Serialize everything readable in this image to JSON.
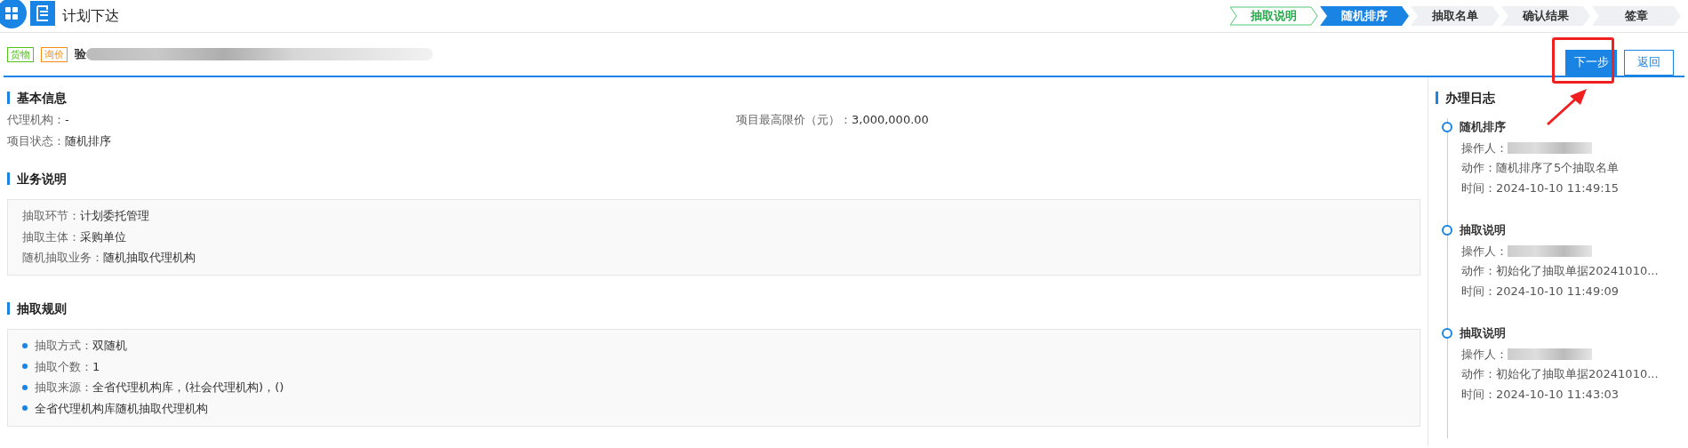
{
  "header": {
    "title": "计划下达"
  },
  "steps": [
    {
      "label": "抽取说明",
      "done": true,
      "selected": false
    },
    {
      "label": "随机排序",
      "done": false,
      "selected": true
    },
    {
      "label": "抽取名单",
      "done": false,
      "selected": false
    },
    {
      "label": "确认结果",
      "done": false,
      "selected": false
    },
    {
      "label": "签章",
      "done": false,
      "selected": false
    }
  ],
  "project": {
    "tags": [
      {
        "label": "货物",
        "color": "#52c41a"
      },
      {
        "label": "询价",
        "color": "#fa8c16"
      }
    ],
    "name": "验"
  },
  "buttons": [
    {
      "label": "下一步",
      "kind": "primary"
    },
    {
      "label": "返回",
      "kind": "outline"
    }
  ],
  "basic_info": {
    "title": "基本信息",
    "rows": [
      [
        {
          "label": "代理机构：",
          "value": "-"
        },
        {
          "label": "项目最高限价（元）：",
          "value": "3,000,000.00"
        }
      ],
      [
        {
          "label": "项目状态：",
          "value": "随机排序"
        }
      ]
    ]
  },
  "business": {
    "title": "业务说明",
    "fields": [
      {
        "label": "抽取环节：",
        "value": "计划委托管理"
      },
      {
        "label": "抽取主体：",
        "value": "采购单位"
      },
      {
        "label": "随机抽取业务：",
        "value": "随机抽取代理机构"
      }
    ]
  },
  "rules": {
    "title": "抽取规则",
    "items": [
      {
        "label": "抽取方式：",
        "value": "双随机"
      },
      {
        "label": "抽取个数：",
        "value": "1"
      },
      {
        "label": "抽取来源：",
        "value": "全省代理机构库，(社会代理机构)，()"
      },
      {
        "value": "全省代理机构库随机抽取代理机构"
      }
    ]
  },
  "log": {
    "title": "办理日志",
    "entries": [
      {
        "title": "随机排序",
        "operator_label": "操作人：",
        "action": "动作：随机排序了5个抽取名单",
        "time": "时间：2024-10-10 11:49:15"
      },
      {
        "title": "抽取说明",
        "operator_label": "操作人：",
        "action": "动作：初始化了抽取单据20241010...",
        "time": "时间：2024-10-10 11:49:09"
      },
      {
        "title": "抽取说明",
        "operator_label": "操作人：",
        "action": "动作：初始化了抽取单据20241010...",
        "time": "时间：2024-10-10 11:43:03"
      }
    ]
  }
}
